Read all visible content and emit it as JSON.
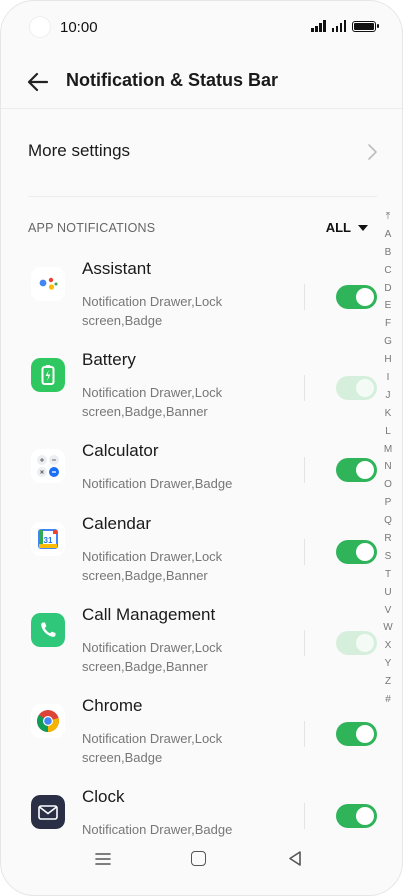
{
  "status_bar": {
    "time": "10:00"
  },
  "header": {
    "title": "Notification & Status Bar"
  },
  "more_settings": {
    "label": "More settings"
  },
  "section": {
    "title": "APP NOTIFICATIONS",
    "filter_label": "ALL"
  },
  "alphabet": [
    "⤒",
    "A",
    "B",
    "C",
    "D",
    "E",
    "F",
    "G",
    "H",
    "I",
    "J",
    "K",
    "L",
    "M",
    "N",
    "O",
    "P",
    "Q",
    "R",
    "S",
    "T",
    "U",
    "V",
    "W",
    "X",
    "Y",
    "Z",
    "#"
  ],
  "apps": [
    {
      "name": "Assistant",
      "desc": "Notification Drawer,Lock screen,Badge",
      "enabled": true,
      "locked": false,
      "icon": "google-assistant-icon"
    },
    {
      "name": "Battery",
      "desc": "Notification Drawer,Lock screen,Badge,Banner",
      "enabled": true,
      "locked": true,
      "icon": "battery-app-icon"
    },
    {
      "name": "Calculator",
      "desc": "Notification Drawer,Badge",
      "enabled": true,
      "locked": false,
      "icon": "calculator-icon"
    },
    {
      "name": "Calendar",
      "desc": "Notification Drawer,Lock screen,Badge,Banner",
      "enabled": true,
      "locked": false,
      "icon": "calendar-icon"
    },
    {
      "name": "Call Management",
      "desc": "Notification Drawer,Lock screen,Badge,Banner",
      "enabled": true,
      "locked": true,
      "icon": "phone-icon"
    },
    {
      "name": "Chrome",
      "desc": "Notification Drawer,Lock screen,Badge",
      "enabled": true,
      "locked": false,
      "icon": "chrome-icon"
    },
    {
      "name": "Clock",
      "desc": "Notification Drawer,Badge",
      "enabled": true,
      "locked": false,
      "icon": "clock-app-icon"
    }
  ],
  "calendar_icon_day": "31",
  "colors": {
    "toggle_on": "#2fb45a",
    "toggle_locked": "#d6efdd"
  }
}
